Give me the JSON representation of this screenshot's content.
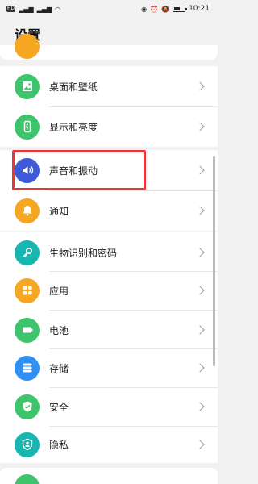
{
  "status_bar": {
    "carrier_badge": "HD",
    "time": "10:21",
    "battery_level": 0.55
  },
  "page": {
    "title": "设置"
  },
  "items": [
    {
      "label": "桌面和壁纸",
      "icon": "wallpaper-icon",
      "color": "#3ec46d"
    },
    {
      "label": "显示和亮度",
      "icon": "display-brightness-icon",
      "color": "#3ec46d"
    },
    {
      "label": "声音和振动",
      "icon": "sound-icon",
      "color": "#3d5bd6"
    },
    {
      "label": "通知",
      "icon": "notification-bell-icon",
      "color": "#f5a623"
    },
    {
      "label": "生物识别和密码",
      "icon": "key-icon",
      "color": "#18b6b0"
    },
    {
      "label": "应用",
      "icon": "apps-grid-icon",
      "color": "#f5a623"
    },
    {
      "label": "电池",
      "icon": "battery-icon",
      "color": "#3ec46d"
    },
    {
      "label": "存储",
      "icon": "storage-icon",
      "color": "#2f8ff2"
    },
    {
      "label": "安全",
      "icon": "shield-check-icon",
      "color": "#3ec46d"
    },
    {
      "label": "隐私",
      "icon": "privacy-user-icon",
      "color": "#18b6b0"
    }
  ],
  "colors": {
    "highlight_box": "#e8363b",
    "background": "#f1f1f1"
  }
}
